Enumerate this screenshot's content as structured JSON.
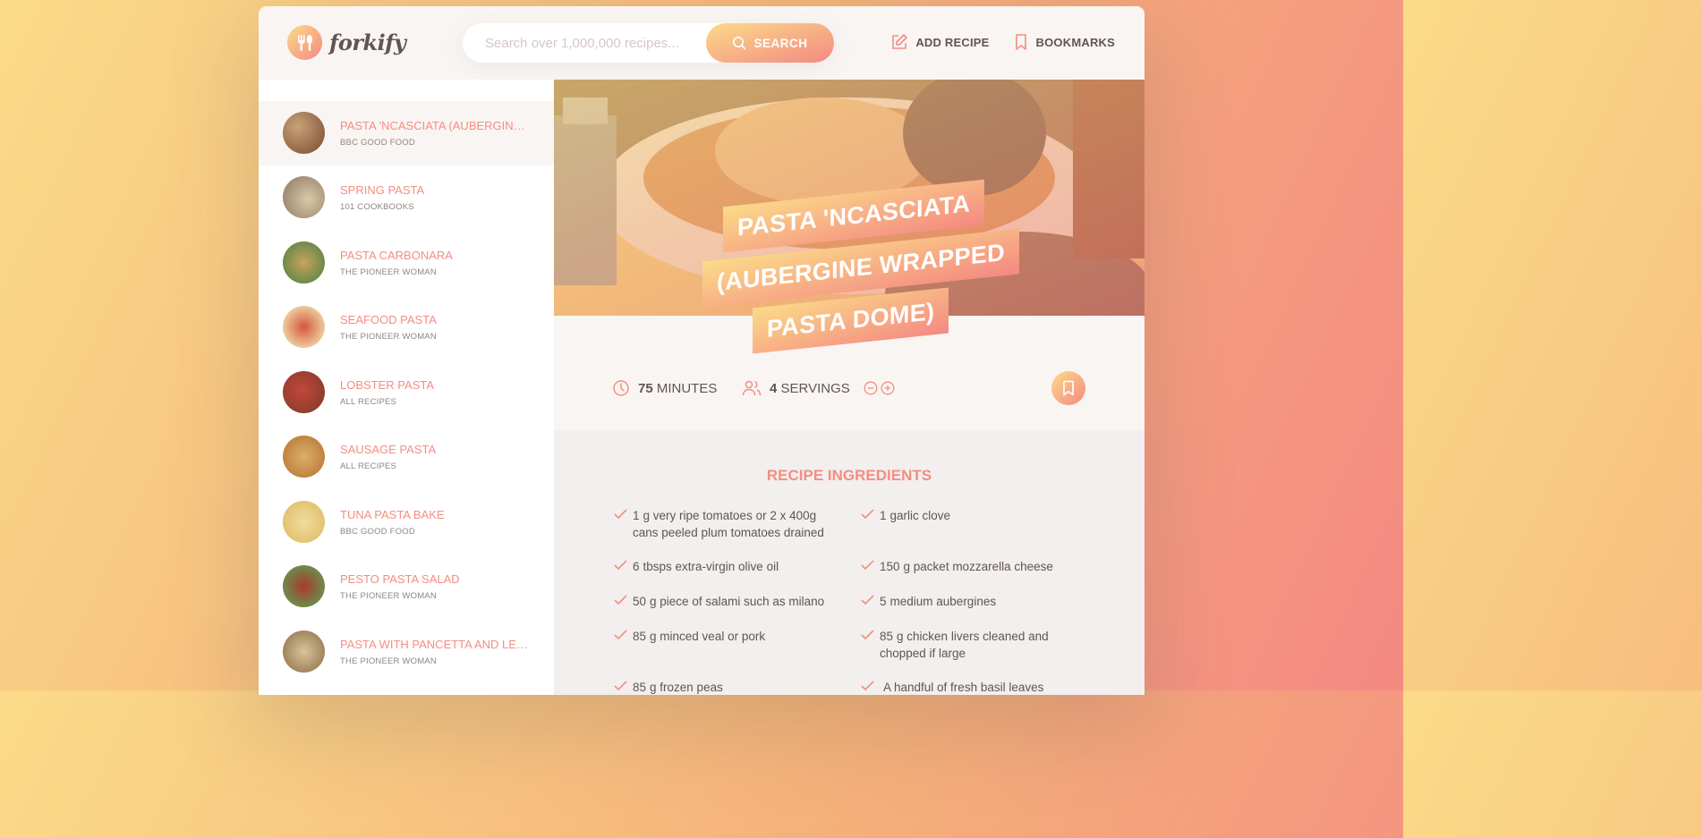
{
  "brand": {
    "name": "forkify"
  },
  "search": {
    "placeholder": "Search over 1,000,000 recipes...",
    "button_label": "SEARCH"
  },
  "nav": {
    "add_recipe": "ADD RECIPE",
    "bookmarks": "BOOKMARKS"
  },
  "results": [
    {
      "title": "PASTA 'NCASCIATA (AUBERGINE ...",
      "publisher": "BBC GOOD FOOD",
      "active": true,
      "colors": [
        "#7b4a2e",
        "#c8a27a"
      ]
    },
    {
      "title": "SPRING PASTA",
      "publisher": "101 COOKBOOKS",
      "active": false,
      "colors": [
        "#8a7460",
        "#d9c9a8"
      ]
    },
    {
      "title": "PASTA CARBONARA",
      "publisher": "THE PIONEER WOMAN",
      "active": false,
      "colors": [
        "#c9a35b",
        "#6e8a4a"
      ]
    },
    {
      "title": "SEAFOOD PASTA",
      "publisher": "THE PIONEER WOMAN",
      "active": false,
      "colors": [
        "#d5563d",
        "#eed2a2"
      ]
    },
    {
      "title": "LOBSTER PASTA",
      "publisher": "ALL RECIPES",
      "active": false,
      "colors": [
        "#c2473a",
        "#7a3a2a"
      ]
    },
    {
      "title": "SAUSAGE PASTA",
      "publisher": "ALL RECIPES",
      "active": false,
      "colors": [
        "#b8702f",
        "#d9b06a"
      ]
    },
    {
      "title": "TUNA PASTA BAKE",
      "publisher": "BBC GOOD FOOD",
      "active": false,
      "colors": [
        "#e3c36f",
        "#f0dca0"
      ]
    },
    {
      "title": "PESTO PASTA SALAD",
      "publisher": "THE PIONEER WOMAN",
      "active": false,
      "colors": [
        "#a83a2e",
        "#6e8a4a"
      ]
    },
    {
      "title": "PASTA WITH PANCETTA AND LEE...",
      "publisher": "THE PIONEER WOMAN",
      "active": false,
      "colors": [
        "#d9c49a",
        "#8a6a44"
      ]
    }
  ],
  "recipe": {
    "title_lines": [
      "PASTA 'NCASCIATA",
      "(AUBERGINE WRAPPED",
      "PASTA DOME)"
    ],
    "cooking_time": "75",
    "time_unit": "MINUTES",
    "servings": "4",
    "servings_unit": "SERVINGS",
    "ingredients_heading": "RECIPE INGREDIENTS",
    "ingredients": [
      {
        "quantity": "1",
        "description": "g very ripe tomatoes or 2 x 400g cans peeled plum tomatoes drained"
      },
      {
        "quantity": "1",
        "description": "garlic clove"
      },
      {
        "quantity": "6",
        "description": "tbsps extra-virgin olive oil"
      },
      {
        "quantity": "150",
        "description": "g packet mozzarella cheese"
      },
      {
        "quantity": "50",
        "description": "g piece of salami such as milano"
      },
      {
        "quantity": "5",
        "description": "medium aubergines"
      },
      {
        "quantity": "85",
        "description": "g minced veal or pork"
      },
      {
        "quantity": "85",
        "description": "g chicken livers cleaned and chopped if large"
      },
      {
        "quantity": "85",
        "description": "g frozen peas"
      },
      {
        "quantity": "",
        "description": "A handful of fresh basil leaves"
      }
    ]
  },
  "colors": {
    "accent": "#f38e82",
    "accent_light": "#fbdb89",
    "text": "#615551",
    "muted": "#918581"
  }
}
